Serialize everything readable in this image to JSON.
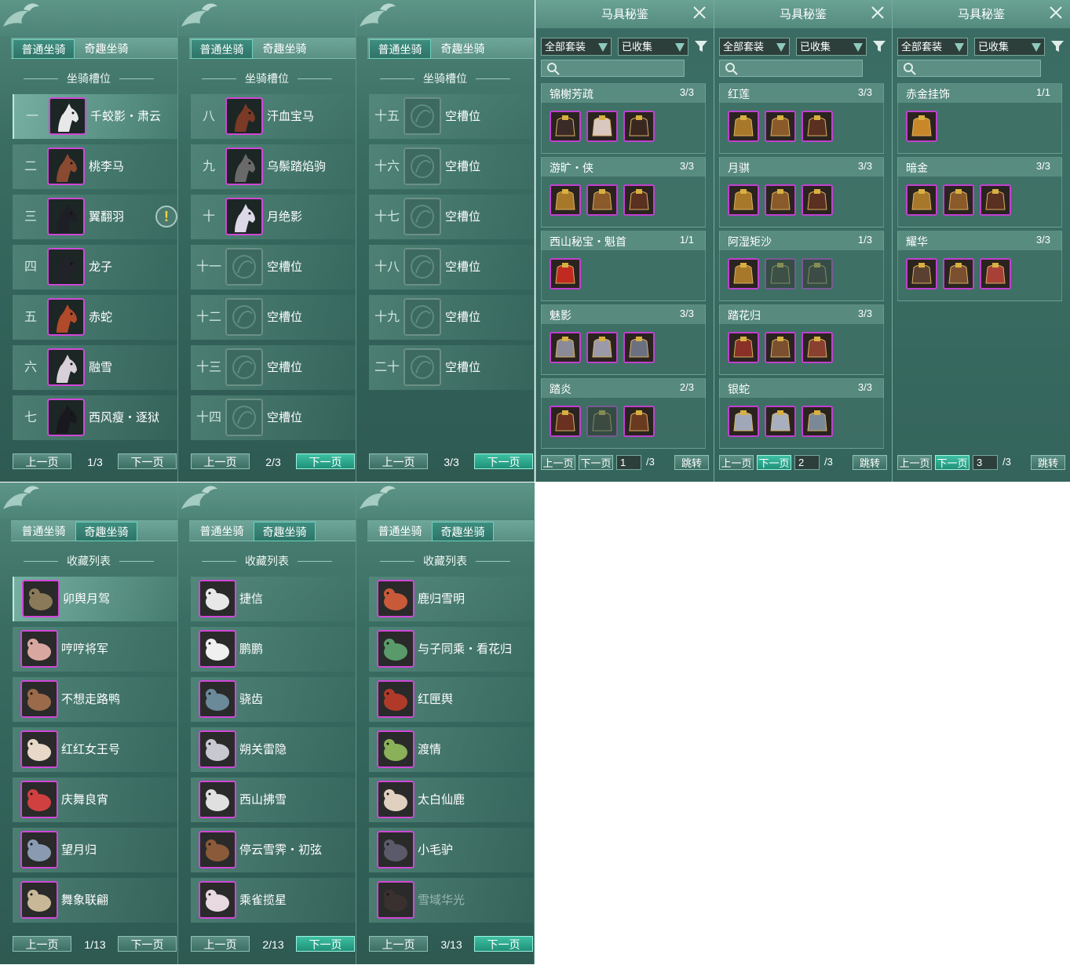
{
  "tabs": {
    "normal": "普通坐骑",
    "fun": "奇趣坐骑"
  },
  "slots_title": "坐骑槽位",
  "collection_title": "收藏列表",
  "pager": {
    "prev": "上一页",
    "next": "下一页"
  },
  "slot_pages": [
    {
      "page": "1/3",
      "rows": [
        {
          "num": "一",
          "name": "千蛟影・肃云",
          "icon": "white-horse-icon",
          "color": "#e8e8e8"
        },
        {
          "num": "二",
          "name": "桃李马",
          "icon": "brown-horse-icon",
          "color": "#8a4a32"
        },
        {
          "num": "三",
          "name": "翼翻羽",
          "icon": "black-horse-icon",
          "color": "#1e1e26",
          "alert": "!"
        },
        {
          "num": "四",
          "name": "龙子",
          "icon": "black-horse-icon",
          "color": "#22222a"
        },
        {
          "num": "五",
          "name": "赤蛇",
          "icon": "red-horse-icon",
          "color": "#b04a2a"
        },
        {
          "num": "六",
          "name": "融雪",
          "icon": "white-horse-icon",
          "color": "#d8d0d8"
        },
        {
          "num": "七",
          "name": "西风瘦・逐狱",
          "icon": "black-horse-icon",
          "color": "#18181e"
        }
      ]
    },
    {
      "page": "2/3",
      "rows": [
        {
          "num": "八",
          "name": "汗血宝马",
          "icon": "brown-horse-icon",
          "color": "#7a3a26"
        },
        {
          "num": "九",
          "name": "乌鬃踏焰驹",
          "icon": "pinto-horse-icon",
          "color": "#6a6a6a"
        },
        {
          "num": "十",
          "name": "月绝影",
          "icon": "white-horse-icon",
          "color": "#ddd8e8"
        },
        {
          "num": "十一",
          "name": "空槽位",
          "icon": "empty-slot-icon",
          "empty": true
        },
        {
          "num": "十二",
          "name": "空槽位",
          "icon": "empty-slot-icon",
          "empty": true
        },
        {
          "num": "十三",
          "name": "空槽位",
          "icon": "empty-slot-icon",
          "empty": true
        },
        {
          "num": "十四",
          "name": "空槽位",
          "icon": "empty-slot-icon",
          "empty": true
        }
      ]
    },
    {
      "page": "3/3",
      "rows": [
        {
          "num": "十五",
          "name": "空槽位",
          "icon": "empty-slot-icon",
          "empty": true
        },
        {
          "num": "十六",
          "name": "空槽位",
          "icon": "empty-slot-icon",
          "empty": true
        },
        {
          "num": "十七",
          "name": "空槽位",
          "icon": "empty-slot-icon",
          "empty": true
        },
        {
          "num": "十八",
          "name": "空槽位",
          "icon": "empty-slot-icon",
          "empty": true
        },
        {
          "num": "十九",
          "name": "空槽位",
          "icon": "empty-slot-icon",
          "empty": true
        },
        {
          "num": "二十",
          "name": "空槽位",
          "icon": "empty-slot-icon",
          "empty": true
        }
      ]
    }
  ],
  "collection_pages": [
    {
      "page": "1/13",
      "rows": [
        {
          "name": "卯舆月驾",
          "icon": "carriage-icon",
          "color": "#8a7a5a"
        },
        {
          "name": "哼哼将军",
          "icon": "pig-icon",
          "color": "#d8a8a0"
        },
        {
          "name": "不想走路鸭",
          "icon": "duck-icon",
          "color": "#9a6a4a"
        },
        {
          "name": "红红女王号",
          "icon": "cat-icon",
          "color": "#e8d8c8"
        },
        {
          "name": "庆舞良宵",
          "icon": "lion-dance-icon",
          "color": "#d04040"
        },
        {
          "name": "望月归",
          "icon": "crane-icon",
          "color": "#8a9ab0"
        },
        {
          "name": "舞象联翩",
          "icon": "elephant-icon",
          "color": "#c8b898"
        }
      ]
    },
    {
      "page": "2/13",
      "rows": [
        {
          "name": "捷信",
          "icon": "elephant-icon",
          "color": "#e8e8e8"
        },
        {
          "name": "鹏鹏",
          "icon": "sheep-icon",
          "color": "#f0f0f0"
        },
        {
          "name": "骁齿",
          "icon": "shark-icon",
          "color": "#6a8a9a"
        },
        {
          "name": "朔关雷隐",
          "icon": "white-horse-icon",
          "color": "#c8c8d0"
        },
        {
          "name": "西山拂雪",
          "icon": "deer-icon",
          "color": "#e0e0e0"
        },
        {
          "name": "停云雪霁・初弦",
          "icon": "boat-icon",
          "color": "#8a5a3a"
        },
        {
          "name": "乘雀揽星",
          "icon": "lotus-icon",
          "color": "#e8d8e0"
        }
      ]
    },
    {
      "page": "3/13",
      "rows": [
        {
          "name": "鹿归雪明",
          "icon": "deer-cart-icon",
          "color": "#c85a3a"
        },
        {
          "name": "与子同乘・看花归",
          "icon": "flower-cart-icon",
          "color": "#5a9a6a"
        },
        {
          "name": "红匣舆",
          "icon": "red-box-icon",
          "color": "#b03a2a"
        },
        {
          "name": "渡情",
          "icon": "bamboo-raft-icon",
          "color": "#8ab05a"
        },
        {
          "name": "太白仙鹿",
          "icon": "antler-icon",
          "color": "#e0d0c0"
        },
        {
          "name": "小毛驴",
          "icon": "donkey-icon",
          "color": "#5a5a6a"
        },
        {
          "name": "雪域华光",
          "icon": "dark-deer-icon",
          "color": "#3a3030",
          "dim": true
        }
      ]
    }
  ],
  "saddle": {
    "title": "马具秘鉴",
    "all_sets": "全部套装",
    "collected": "已收集",
    "jump": "跳转",
    "prev": "上一页",
    "next": "下一页",
    "pages": [
      {
        "input": "1",
        "total": "/3",
        "sets": [
          {
            "name": "锦榭芳疏",
            "count": "3/3",
            "pieces": [
              "#3a2a28",
              "#d8c8c0",
              "#3a2820"
            ]
          },
          {
            "name": "游旷・侠",
            "count": "3/3",
            "pieces": [
              "#a8782a",
              "#8a5a2a",
              "#5a3020"
            ]
          },
          {
            "name": "西山秘宝・魁首",
            "count": "1/1",
            "pieces": [
              "#c02a20"
            ]
          },
          {
            "name": "魅影",
            "count": "3/3",
            "pieces": [
              "#8a8a98",
              "#9a9aa8",
              "#6a7080"
            ]
          },
          {
            "name": "踏炎",
            "count": "2/3",
            "pieces": [
              "#6a3020",
              "#3a2018",
              "#6a3a20"
            ],
            "dim": [
              1
            ]
          }
        ]
      },
      {
        "input": "2",
        "total": "/3",
        "sets": [
          {
            "name": "红莲",
            "count": "3/3",
            "pieces": [
              "#a8782a",
              "#8a5a2a",
              "#5a3020"
            ]
          },
          {
            "name": "月骐",
            "count": "3/3",
            "pieces": [
              "#a8782a",
              "#8a5a2a",
              "#5a3020"
            ]
          },
          {
            "name": "阿湿矩沙",
            "count": "1/3",
            "pieces": [
              "#a8782a",
              "#3a2a20",
              "#3a2220"
            ],
            "dim": [
              1,
              2
            ]
          },
          {
            "name": "踏花归",
            "count": "3/3",
            "pieces": [
              "#8a3028",
              "#7a5030",
              "#8a4030"
            ]
          },
          {
            "name": "银蛇",
            "count": "3/3",
            "pieces": [
              "#a0a8b8",
              "#a8b0c0",
              "#7a8898"
            ]
          }
        ]
      },
      {
        "input": "3",
        "total": "/3",
        "sets": [
          {
            "name": "赤金挂饰",
            "count": "1/1",
            "pieces": [
              "#c8882a"
            ]
          },
          {
            "name": "暗金",
            "count": "3/3",
            "pieces": [
              "#a8782a",
              "#8a5a2a",
              "#5a3020"
            ]
          },
          {
            "name": "耀华",
            "count": "3/3",
            "pieces": [
              "#5a4030",
              "#7a5030",
              "#a84038"
            ]
          }
        ]
      }
    ]
  }
}
